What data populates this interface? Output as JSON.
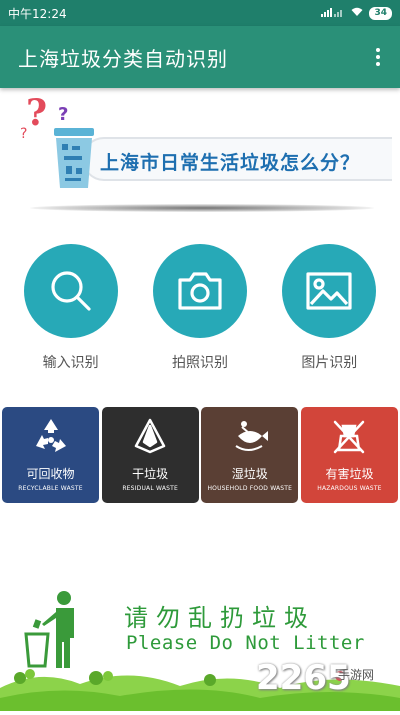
{
  "status_bar": {
    "time": "中午12:24",
    "battery": "34"
  },
  "app_bar": {
    "title": "上海垃圾分类自动识别",
    "menu_icon": "more-vert-icon"
  },
  "banner": {
    "headline": "上海市日常生活垃圾怎么分？",
    "q1": "?",
    "q2": "?",
    "q3": "?"
  },
  "actions": [
    {
      "label": "输入识别",
      "icon": "search-icon"
    },
    {
      "label": "拍照识别",
      "icon": "camera-icon"
    },
    {
      "label": "图片识别",
      "icon": "image-icon"
    }
  ],
  "categories": [
    {
      "zh": "可回收物",
      "en": "RECYCLABLE WASTE",
      "icon": "recycle-icon",
      "color": "#2b4a82"
    },
    {
      "zh": "干垃圾",
      "en": "RESIDUAL WASTE",
      "icon": "residual-waste-icon",
      "color": "#2e2e2e"
    },
    {
      "zh": "湿垃圾",
      "en": "HOUSEHOLD FOOD WASTE",
      "icon": "food-waste-icon",
      "color": "#5a3f34"
    },
    {
      "zh": "有害垃圾",
      "en": "HAZARDOUS WASTE",
      "icon": "hazardous-waste-icon",
      "color": "#d2453a"
    }
  ],
  "footer": {
    "slogan_zh": "请勿乱扔垃圾",
    "slogan_en": "Please Do Not Litter",
    "watermark": "2265",
    "watermark_sub": "手游网"
  }
}
